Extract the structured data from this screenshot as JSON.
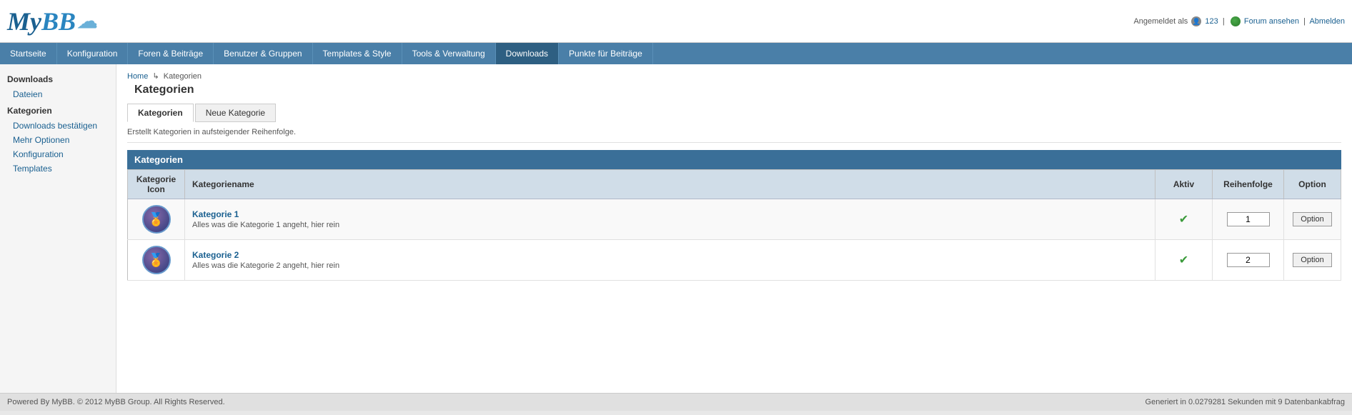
{
  "header": {
    "logo_my": "My",
    "logo_bb": "BB",
    "cloud": "☁",
    "user_label": "Angemeldet als",
    "user_name": "123",
    "forum_link": "Forum ansehen",
    "logout_link": "Abmelden"
  },
  "nav": {
    "items": [
      {
        "label": "Startseite",
        "active": false
      },
      {
        "label": "Konfiguration",
        "active": false
      },
      {
        "label": "Foren & Beiträge",
        "active": false
      },
      {
        "label": "Benutzer & Gruppen",
        "active": false
      },
      {
        "label": "Templates & Style",
        "active": false
      },
      {
        "label": "Tools & Verwaltung",
        "active": false
      },
      {
        "label": "Downloads",
        "active": true
      },
      {
        "label": "Punkte für Beiträge",
        "active": false
      }
    ]
  },
  "sidebar": {
    "section1": "Downloads",
    "link1": "Dateien",
    "section2": "Kategorien",
    "link2": "Downloads bestätigen",
    "link3": "Mehr Optionen",
    "link4": "Konfiguration",
    "link5": "Templates"
  },
  "breadcrumb": {
    "home": "Home",
    "current": "Kategorien"
  },
  "page_title": "Kategorien",
  "tabs": {
    "tab1": "Kategorien",
    "tab2": "Neue Kategorie"
  },
  "description": "Erstellt Kategorien in aufsteigender Reihenfolge.",
  "table": {
    "header": "Kategorien",
    "col1": "Kategorie Icon",
    "col2": "Kategoriename",
    "col3": "Aktiv",
    "col4": "Reihenfolge",
    "col5": "Option",
    "rows": [
      {
        "name": "Kategorie 1",
        "desc": "Alles was die Kategorie 1 angeht, hier rein",
        "active": true,
        "order": "1",
        "option_label": "Option"
      },
      {
        "name": "Kategorie 2",
        "desc": "Alles was die Kategorie 2 angeht, hier rein",
        "active": true,
        "order": "2",
        "option_label": "Option"
      }
    ]
  },
  "footer": {
    "left": "Powered By MyBB. © 2012 MyBB Group. All Rights Reserved.",
    "right": "Generiert in 0.0279281 Sekunden mit 9 Datenbankabfrag"
  }
}
